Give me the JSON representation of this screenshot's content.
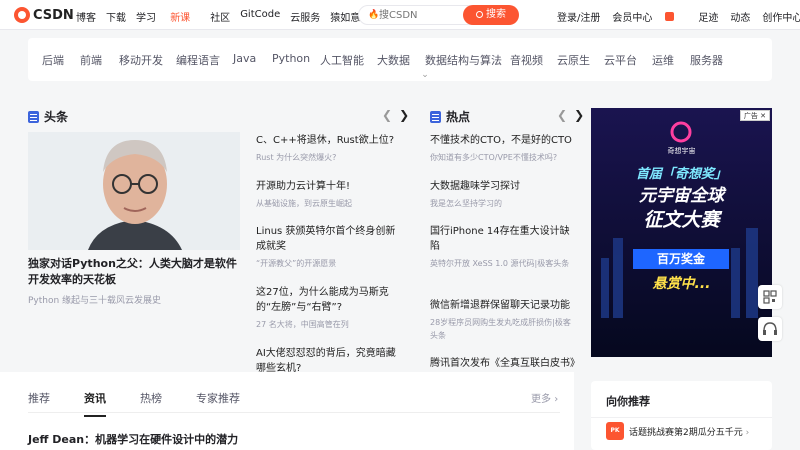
{
  "topbar": {
    "logo_text": "CSDN",
    "nav": [
      "博客",
      "下载",
      "学习",
      "社区",
      "GitCode",
      "云服务",
      "猿如意"
    ],
    "nav_hot": "新课",
    "search_placeholder": "搜CSDN",
    "search_button": "搜索",
    "user": [
      "登录/注册",
      "会员中心",
      "足迹",
      "动态",
      "创作中心"
    ],
    "brand_color": "#fc5531"
  },
  "categories": [
    "后端",
    "前端",
    "移动开发",
    "编程语言",
    "Java",
    "Python",
    "人工智能",
    "大数据",
    "数据结构与算法",
    "音视频",
    "云原生",
    "云平台",
    "运维",
    "服务器"
  ],
  "headlines": {
    "title": "头条",
    "hero_title": "独家对话Python之父：人类大脑才是软件开发效率的天花板",
    "hero_sub": "Python 缘起与三十载风云发展史",
    "items": [
      {
        "title": "C、C++将退休，Rust欲上位?",
        "sub": "Rust 为什么突然爆火?"
      },
      {
        "title": "开源助力云计算十年!",
        "sub": "从基础设施，到云原生崛起"
      },
      {
        "title": "Linus 获颁英特尔首个终身创新成就奖",
        "sub": "“开源教父”的开源愿景"
      },
      {
        "title": "这27位，为什么能成为马斯克的“左膀”与“右臂”?",
        "sub": "27 名大将，中国高管在列"
      },
      {
        "title": "AI大佬怼怼怼的背后，究竟暗藏哪些玄机?",
        "sub": ""
      }
    ]
  },
  "hot": {
    "title": "热点",
    "items": [
      {
        "title": "不懂技术的CTO，不是好的CTO",
        "sub": "你知道有多少CTO/VPE不懂技术吗?"
      },
      {
        "title": "大数据趣味学习探讨",
        "sub": "我是怎么坚持学习的"
      },
      {
        "title": "国行iPhone 14存在重大设计缺陷",
        "sub": "英特尔开放 XeSS 1.0 源代码|极客头条"
      },
      {
        "title": "微信新增退群保留聊天记录功能",
        "sub": "28岁程序员网购生发丸吃成肝损伤|极客头条"
      },
      {
        "title": "腾讯首次发布《全真互联白皮书》",
        "sub": ""
      }
    ]
  },
  "ad": {
    "tag": "广告",
    "brand": "奇想宇宙",
    "line1": "首届「奇想奖」",
    "line2": "元宇宙全球",
    "line3": "征文大赛",
    "line4": "百万奖金",
    "line5": "悬赏中..."
  },
  "feed": {
    "tabs": [
      "推荐",
      "资讯",
      "热榜",
      "专家推荐"
    ],
    "active_tab": "资讯",
    "more": "更多",
    "first_title": "Jeff Dean：机器学习在硬件设计中的潜力"
  },
  "recommend": {
    "title": "向你推荐",
    "icon_text": "PK",
    "item": "话题挑战赛第2期瓜分五千元"
  }
}
